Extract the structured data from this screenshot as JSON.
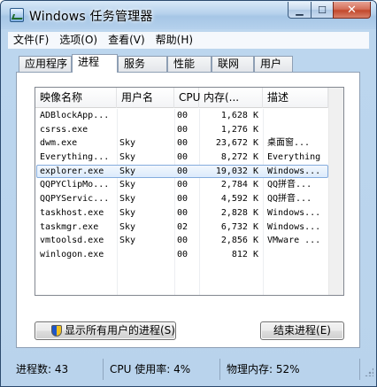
{
  "window": {
    "title": "Windows 任务管理器",
    "buttons": {
      "minimize": "▁",
      "maximize": "☐",
      "close": "✕"
    }
  },
  "menu": [
    "文件(F)",
    "选项(O)",
    "查看(V)",
    "帮助(H)"
  ],
  "tabs": [
    "应用程序",
    "进程",
    "服务",
    "性能",
    "联网",
    "用户"
  ],
  "active_tab": "进程",
  "columns": [
    "映像名称",
    "用户名",
    "CPU",
    "内存(...",
    "描述"
  ],
  "processes": [
    {
      "name": "ADBlockApp...",
      "user": "",
      "cpu": "00",
      "mem": "1,628 K",
      "desc": ""
    },
    {
      "name": "csrss.exe",
      "user": "",
      "cpu": "00",
      "mem": "1,276 K",
      "desc": ""
    },
    {
      "name": "dwm.exe",
      "user": "Sky",
      "cpu": "00",
      "mem": "23,672 K",
      "desc": "桌面窗..."
    },
    {
      "name": "Everything...",
      "user": "Sky",
      "cpu": "00",
      "mem": "8,272 K",
      "desc": "Everything"
    },
    {
      "name": "explorer.exe",
      "user": "Sky",
      "cpu": "00",
      "mem": "19,032 K",
      "desc": "Windows..."
    },
    {
      "name": "QQPYClipMo...",
      "user": "Sky",
      "cpu": "00",
      "mem": "2,784 K",
      "desc": "QQ拼音..."
    },
    {
      "name": "QQPYServic...",
      "user": "Sky",
      "cpu": "00",
      "mem": "4,592 K",
      "desc": "QQ拼音..."
    },
    {
      "name": "taskhost.exe",
      "user": "Sky",
      "cpu": "00",
      "mem": "2,828 K",
      "desc": "Windows..."
    },
    {
      "name": "taskmgr.exe",
      "user": "Sky",
      "cpu": "02",
      "mem": "6,732 K",
      "desc": "Windows..."
    },
    {
      "name": "vmtoolsd.exe",
      "user": "Sky",
      "cpu": "00",
      "mem": "2,856 K",
      "desc": "VMware ..."
    },
    {
      "name": "winlogon.exe",
      "user": "",
      "cpu": "00",
      "mem": "812 K",
      "desc": ""
    }
  ],
  "selected_row": 4,
  "buttons": {
    "show_all": "显示所有用户的进程(S)",
    "end_process": "结束进程(E)"
  },
  "status": {
    "processes": "进程数: 43",
    "cpu": "CPU 使用率: 4%",
    "memory": "物理内存: 52%"
  },
  "colors": {
    "title_bar": "#b6d1ec",
    "selection": "#dcebfc",
    "close_button": "#c2482c"
  }
}
